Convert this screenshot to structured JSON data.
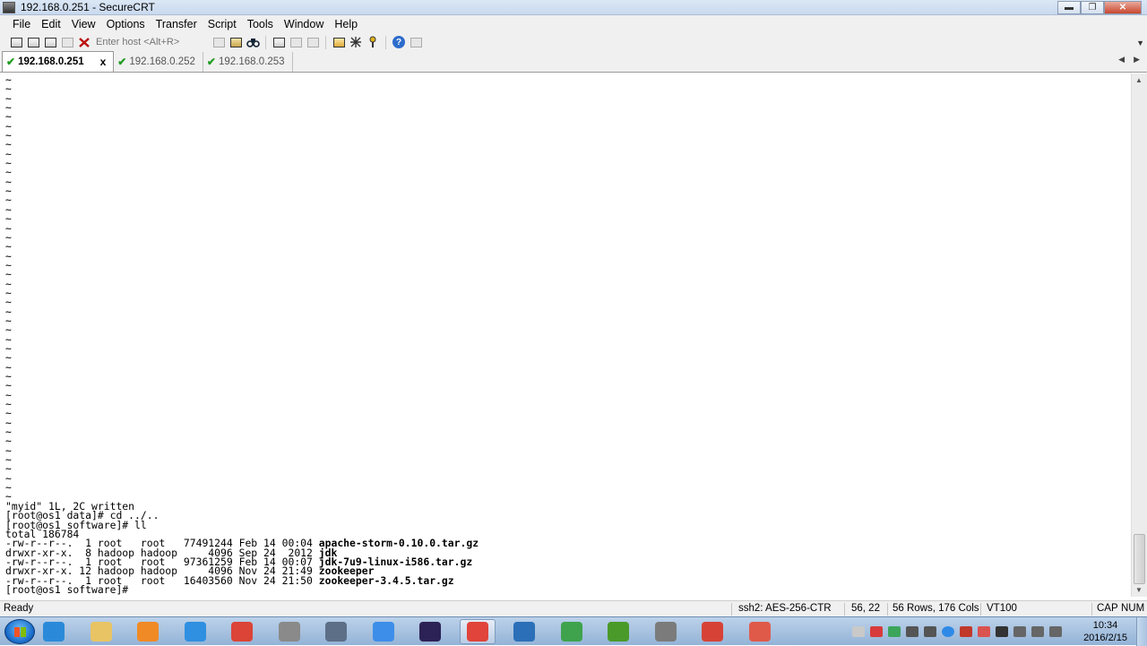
{
  "window": {
    "title": "192.168.0.251 - SecureCRT",
    "controls": {
      "minimize": "▬",
      "maximize": "❐",
      "close": "✕"
    }
  },
  "menu": [
    "File",
    "Edit",
    "View",
    "Options",
    "Transfer",
    "Script",
    "Tools",
    "Window",
    "Help"
  ],
  "toolbar": {
    "host_placeholder": "Enter host <Alt+R>",
    "icons": [
      "connect-icon",
      "quick-connect-icon",
      "connect-tab-icon",
      "reconnect-icon",
      "disconnect-icon",
      "copy-icon",
      "paste-icon",
      "find-icon",
      "print-icon",
      "print-selection-icon",
      "print-setup-icon",
      "session-options-icon",
      "global-options-icon",
      "keymap-icon",
      "help-icon",
      "sftp-icon"
    ]
  },
  "tabs": [
    {
      "label": "192.168.0.251",
      "active": true,
      "close": "x"
    },
    {
      "label": "192.168.0.252",
      "active": false
    },
    {
      "label": "192.168.0.253",
      "active": false
    }
  ],
  "terminal": {
    "tilde_count": 46,
    "tilde": "~",
    "lines": [
      {
        "text": "\"myid\" 1L, 2C written"
      },
      {
        "text": "[root@os1 data]# cd ../.."
      },
      {
        "text": "[root@os1 software]# ll"
      },
      {
        "text": "total 186784"
      },
      {
        "prefix": "-rw-r--r--.  1 root   root   77491244 Feb 14 00:04 ",
        "name": "apache-storm-0.10.0.tar.gz"
      },
      {
        "prefix": "drwxr-xr-x.  8 hadoop hadoop     4096 Sep 24  2012 ",
        "name": "jdk"
      },
      {
        "prefix": "-rw-r--r--.  1 root   root   97361259 Feb 14 00:07 ",
        "name": "jdk-7u9-linux-i586.tar.gz"
      },
      {
        "prefix": "drwxr-xr-x. 12 hadoop hadoop     4096 Nov 24 21:49 ",
        "name": "zookeeper"
      },
      {
        "prefix": "-rw-r--r--.  1 root   root   16403560 Nov 24 21:50 ",
        "name": "zookeeper-3.4.5.tar.gz"
      },
      {
        "text": "[root@os1 software]# "
      }
    ]
  },
  "status": {
    "ready": "Ready",
    "cipher": "ssh2: AES-256-CTR",
    "cursor": "56,  22",
    "size": "56 Rows, 176 Cols",
    "emulation": "VT100",
    "caps": "CAP",
    "num": "NUM"
  },
  "taskbar": {
    "apps": [
      {
        "name": "internet-explorer-icon",
        "color": "#2a8ad9"
      },
      {
        "name": "file-explorer-icon",
        "color": "#e8c464"
      },
      {
        "name": "media-player-icon",
        "color": "#f08a24"
      },
      {
        "name": "baidu-cloud-icon",
        "color": "#2f8fe0"
      },
      {
        "name": "chrome-icon",
        "color": "#db4437"
      },
      {
        "name": "securefx-icon",
        "color": "#8a8a8a"
      },
      {
        "name": "securecrt-icon",
        "color": "#5d6f86"
      },
      {
        "name": "feather-icon",
        "color": "#3d8ee8"
      },
      {
        "name": "eclipse-icon",
        "color": "#2c2255"
      },
      {
        "name": "archive-icon",
        "color": "#e0443a"
      },
      {
        "name": "virtualbox-icon",
        "color": "#2b6fb8"
      },
      {
        "name": "pycharm-icon",
        "color": "#3fa34d"
      },
      {
        "name": "mindmanager-icon",
        "color": "#4a9a2a"
      },
      {
        "name": "remote-tool-icon",
        "color": "#7b7b7b"
      },
      {
        "name": "xmind-icon",
        "color": "#d64236"
      },
      {
        "name": "eraser-icon",
        "color": "#e05a4a"
      }
    ],
    "clock_time": "10:34",
    "clock_date": "2016/2/15"
  }
}
